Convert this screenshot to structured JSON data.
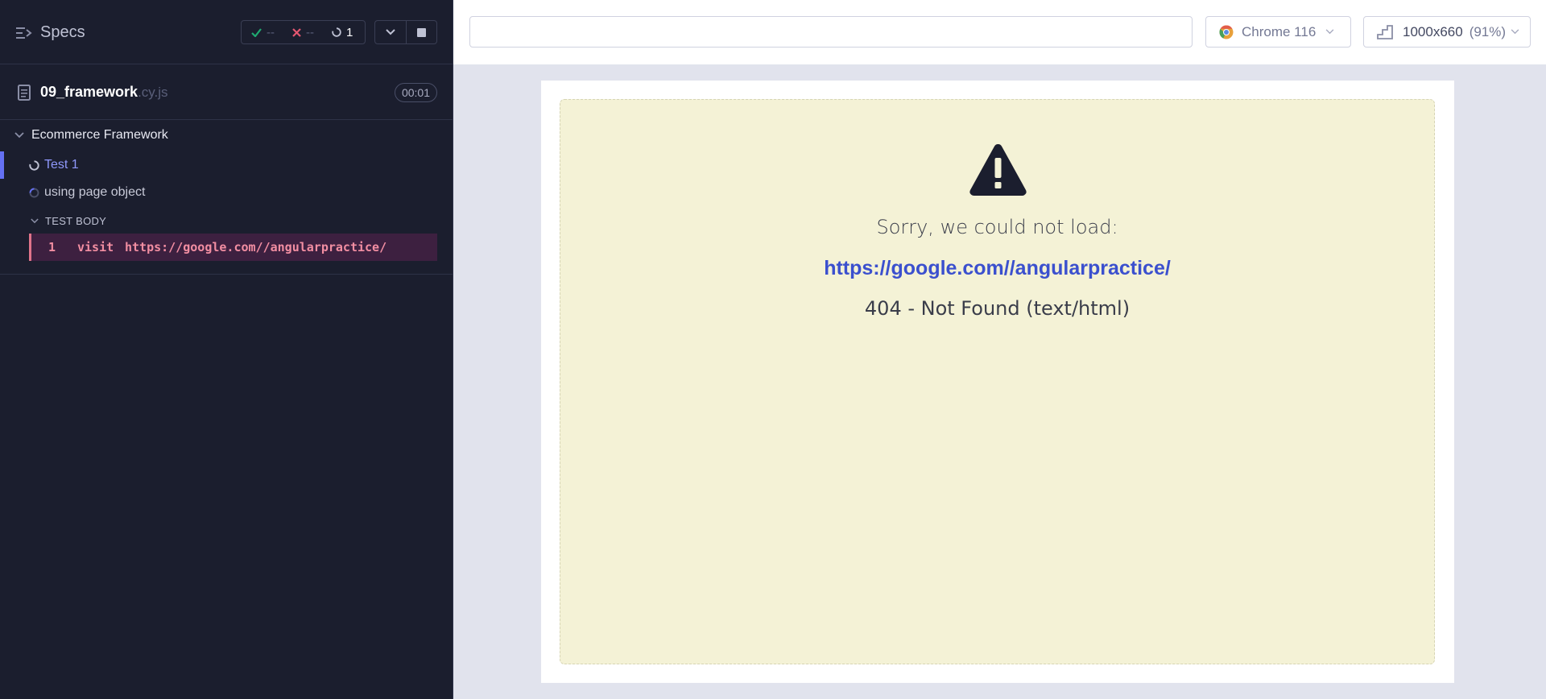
{
  "reporter": {
    "specs_label": "Specs",
    "stats": {
      "passed": "--",
      "failed": "--",
      "pending": "1"
    },
    "spec": {
      "name": "09_framework",
      "ext": ".cy.js",
      "duration": "00:01"
    },
    "suite": {
      "title": "Ecommerce Framework"
    },
    "tests": [
      {
        "title": "Test 1",
        "state": "running"
      },
      {
        "title": "using page object",
        "state": "queued"
      }
    ],
    "test_body_label": "TEST BODY",
    "command": {
      "number": "1",
      "name": "visit",
      "message": "https://google.com//angularpractice/"
    }
  },
  "runner": {
    "url_value": "",
    "browser": "Chrome 116",
    "viewport": "1000x660",
    "zoom": "(91%)"
  },
  "error": {
    "message": "Sorry, we could not load:",
    "url": "https://google.com//angularpractice/",
    "status": "404 - Not Found (text/html)"
  },
  "colors": {
    "reporter_bg": "#1b1e2e",
    "accent": "#6470f3",
    "error_bg": "#f4f2d6",
    "link": "#3b50ce",
    "failed_cmd": "#f28ea2"
  }
}
